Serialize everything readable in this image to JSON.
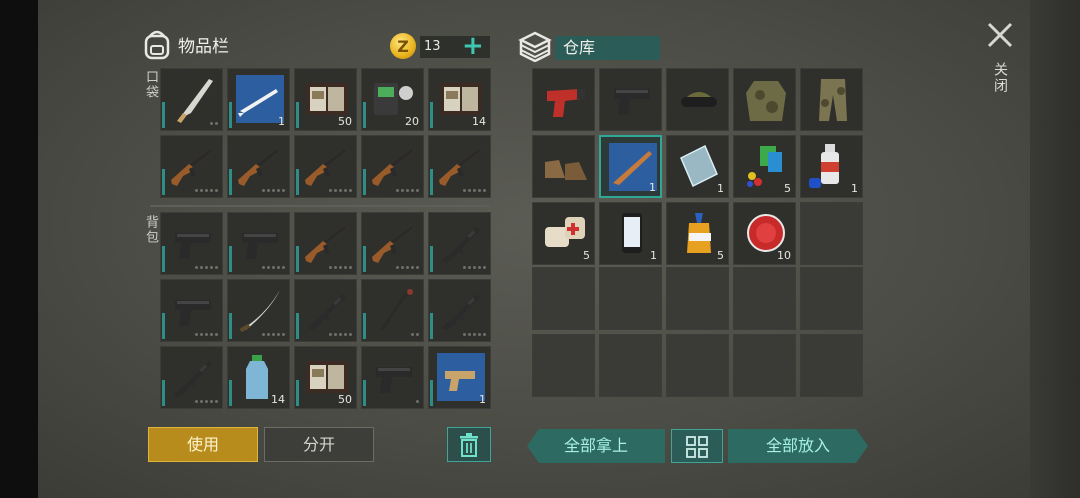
{
  "inventory": {
    "title": "物品栏",
    "coins": "13",
    "pocket_label": "口袋",
    "backpack_label": "背包",
    "pocket": [
      {
        "icon": "machete-icon",
        "count": "",
        "dots": 2
      },
      {
        "icon": "shotgun-blueprint-icon",
        "count": "1"
      },
      {
        "icon": "notebook-icon",
        "count": "50"
      },
      {
        "icon": "id-wallet-icon",
        "count": "20"
      },
      {
        "icon": "notebook-icon",
        "count": "14"
      },
      {
        "icon": "ak-rifle-icon",
        "count": "",
        "dots": 5
      },
      {
        "icon": "ak-rifle-icon",
        "count": "",
        "dots": 5
      },
      {
        "icon": "ak-rifle-icon",
        "count": "",
        "dots": 5
      },
      {
        "icon": "ak-rifle-icon",
        "count": "",
        "dots": 5
      },
      {
        "icon": "ak-rifle-icon",
        "count": "",
        "dots": 5
      }
    ],
    "backpack": [
      {
        "icon": "pistol-icon",
        "count": "",
        "dots": 5
      },
      {
        "icon": "pistol-icon",
        "count": "",
        "dots": 5
      },
      {
        "icon": "ak-rifle-icon",
        "count": "",
        "dots": 5
      },
      {
        "icon": "ak-rifle-icon",
        "count": "",
        "dots": 5
      },
      {
        "icon": "m16-rifle-icon",
        "count": "",
        "dots": 5
      },
      {
        "icon": "pistol-icon",
        "count": "",
        "dots": 5
      },
      {
        "icon": "katana-icon",
        "count": "",
        "dots": 5
      },
      {
        "icon": "m16-rifle-icon",
        "count": "",
        "dots": 5
      },
      {
        "icon": "crowbar-icon",
        "count": "",
        "dots": 2
      },
      {
        "icon": "m16-rifle-icon",
        "count": "",
        "dots": 5
      },
      {
        "icon": "m16-rifle-icon",
        "count": "",
        "dots": 5
      },
      {
        "icon": "water-bottle-icon",
        "count": "14"
      },
      {
        "icon": "notebook-icon",
        "count": "50"
      },
      {
        "icon": "pistol-icon",
        "count": "",
        "dots": 1
      },
      {
        "icon": "pistol-blueprint-icon",
        "count": "1"
      }
    ]
  },
  "warehouse": {
    "title": "仓库",
    "items": [
      {
        "icon": "flare-gun-icon",
        "count": ""
      },
      {
        "icon": "pistol-icon",
        "count": ""
      },
      {
        "icon": "cap-goggles-icon",
        "count": ""
      },
      {
        "icon": "camo-jacket-icon",
        "count": ""
      },
      {
        "icon": "camo-pants-icon",
        "count": ""
      },
      {
        "icon": "boots-icon",
        "count": ""
      },
      {
        "icon": "rifle-blueprint-icon",
        "count": "1",
        "selected": true
      },
      {
        "icon": "glass-pane-icon",
        "count": "1"
      },
      {
        "icon": "color-pieces-icon",
        "count": "5"
      },
      {
        "icon": "spray-can-icon",
        "count": "1"
      },
      {
        "icon": "bandage-icon",
        "count": "5"
      },
      {
        "icon": "smartphone-icon",
        "count": "1"
      },
      {
        "icon": "glue-tube-icon",
        "count": "5"
      },
      {
        "icon": "bottle-cap-icon",
        "count": "10"
      },
      {
        "icon": "",
        "count": ""
      }
    ]
  },
  "buttons": {
    "use": "使用",
    "split": "分开",
    "take_all": "全部拿上",
    "put_all": "全部放入",
    "close": "关闭"
  }
}
